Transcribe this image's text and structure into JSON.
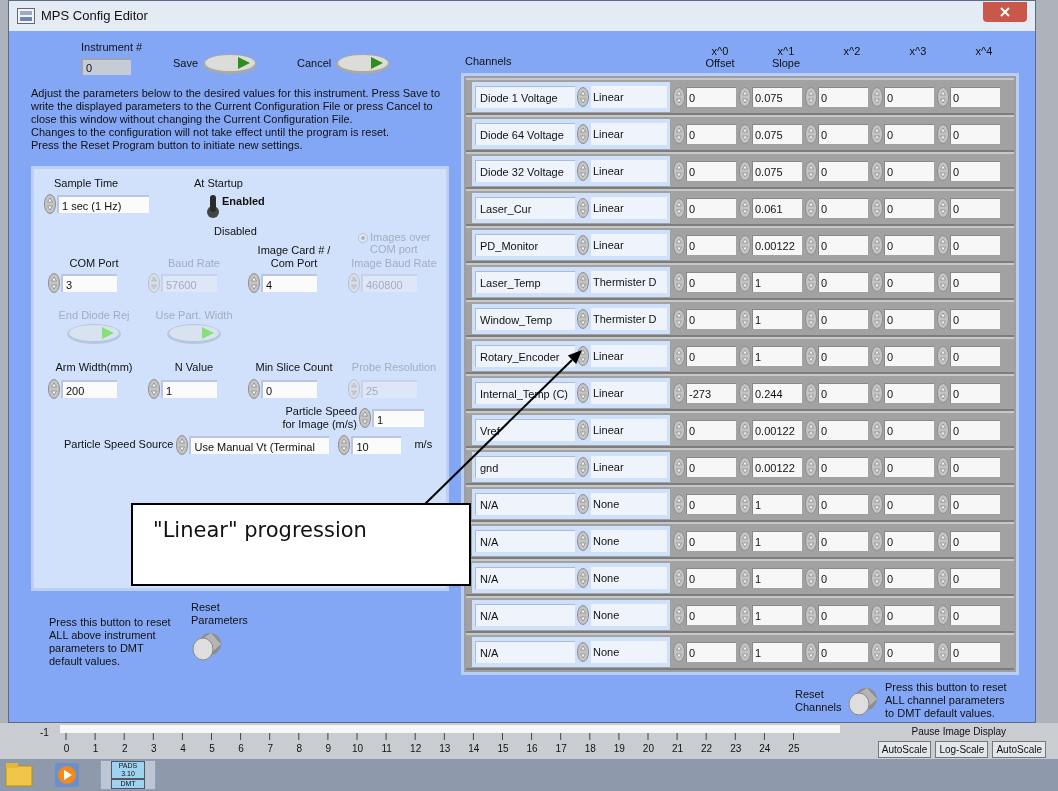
{
  "window": {
    "title": "MPS Config Editor"
  },
  "instrument": {
    "label": "Instrument #",
    "value": "0"
  },
  "actions": [
    {
      "label": "Save"
    },
    {
      "label": "Cancel"
    }
  ],
  "instructions": [
    "Adjust the parameters below to the desired values for this instrument.  Press Save to write the displayed parameters to the Current Configuration File or press Cancel to close this window without changing the Current Configuration File.",
    "Changes to the configuration will not take effect until the program is reset.",
    "Press the Reset Program button to initiate new settings."
  ],
  "sample_time": {
    "label": "Sample Time",
    "value": "1 sec (1 Hz)"
  },
  "at_startup": {
    "label": "At Startup",
    "on_label": "Enabled",
    "off_label": "Disabled",
    "enabled": true
  },
  "images_over_com": {
    "label": "Images over COM port",
    "checked": true,
    "disabled": true
  },
  "port_fields": [
    {
      "label": "COM Port",
      "value": "3",
      "disabled": false
    },
    {
      "label": "Baud Rate",
      "value": "57600",
      "disabled": true
    },
    {
      "label": "Image Card # / Com Port",
      "value": "4",
      "disabled": false
    },
    {
      "label": "Image Baud Rate",
      "value": "460800",
      "disabled": true
    }
  ],
  "switches": [
    {
      "label": "End Diode Rej",
      "disabled": true
    },
    {
      "label": "Use Part. Width",
      "disabled": true
    }
  ],
  "size_fields": [
    {
      "label": "Arm Width(mm)",
      "value": "200",
      "disabled": false
    },
    {
      "label": "N Value",
      "value": "1",
      "disabled": false
    },
    {
      "label": "Min Slice Count",
      "value": "0",
      "disabled": false
    },
    {
      "label": "Probe Resolution",
      "value": "25",
      "disabled": true
    }
  ],
  "particle_speed_image": {
    "label": "Particle Speed for Image (m/s)",
    "value": "1"
  },
  "particle_speed_source": {
    "label": "Particle Speed Source",
    "value": "Use Manual Vt (Terminal",
    "speed": "10",
    "unit": "m/s"
  },
  "reset_parameters": {
    "note": "Press this button to reset ALL above instrument parameters to DMT default values.",
    "label": "Reset Parameters"
  },
  "channels": {
    "title": "Channels",
    "columns": [
      {
        "power": "x^0",
        "name": "Offset"
      },
      {
        "power": "x^1",
        "name": "Slope"
      },
      {
        "power": "x^2"
      },
      {
        "power": "x^3"
      },
      {
        "power": "x^4"
      }
    ],
    "rows": [
      {
        "name": "Diode 1 Voltage",
        "type": "Linear",
        "coefficients": [
          "0",
          "0.075",
          "0",
          "0",
          "0"
        ]
      },
      {
        "name": "Diode 64 Voltage",
        "type": "Linear",
        "coefficients": [
          "0",
          "0.075",
          "0",
          "0",
          "0"
        ]
      },
      {
        "name": "Diode 32 Voltage",
        "type": "Linear",
        "coefficients": [
          "0",
          "0.075",
          "0",
          "0",
          "0"
        ]
      },
      {
        "name": "Laser_Cur",
        "type": "Linear",
        "coefficients": [
          "0",
          "0.061",
          "0",
          "0",
          "0"
        ]
      },
      {
        "name": "PD_Monitor",
        "type": "Linear",
        "coefficients": [
          "0",
          "0.00122",
          "0",
          "0",
          "0"
        ]
      },
      {
        "name": "Laser_Temp",
        "type": "Thermister D",
        "coefficients": [
          "0",
          "1",
          "0",
          "0",
          "0"
        ]
      },
      {
        "name": "Window_Temp",
        "type": "Thermister D",
        "coefficients": [
          "0",
          "1",
          "0",
          "0",
          "0"
        ]
      },
      {
        "name": "Rotary_Encoder",
        "type": "Linear",
        "coefficients": [
          "0",
          "1",
          "0",
          "0",
          "0"
        ]
      },
      {
        "name": "Internal_Temp (C)",
        "type": "Linear",
        "coefficients": [
          "-273",
          "0.244",
          "0",
          "0",
          "0"
        ]
      },
      {
        "name": "Vref",
        "type": "Linear",
        "coefficients": [
          "0",
          "0.00122",
          "0",
          "0",
          "0"
        ]
      },
      {
        "name": "gnd",
        "type": "Linear",
        "coefficients": [
          "0",
          "0.00122",
          "0",
          "0",
          "0"
        ]
      },
      {
        "name": "N/A",
        "type": "None",
        "coefficients": [
          "0",
          "1",
          "0",
          "0",
          "0"
        ]
      },
      {
        "name": "N/A",
        "type": "None",
        "coefficients": [
          "0",
          "1",
          "0",
          "0",
          "0"
        ]
      },
      {
        "name": "N/A",
        "type": "None",
        "coefficients": [
          "0",
          "1",
          "0",
          "0",
          "0"
        ]
      },
      {
        "name": "N/A",
        "type": "None",
        "coefficients": [
          "0",
          "1",
          "0",
          "0",
          "0"
        ]
      },
      {
        "name": "N/A",
        "type": "None",
        "coefficients": [
          "0",
          "1",
          "0",
          "0",
          "0"
        ]
      }
    ]
  },
  "reset_channels": {
    "label": "Reset Channels",
    "note": "Press this button to reset ALL channel parameters to DMT default values."
  },
  "annotation": {
    "text": "\"Linear\" progression"
  },
  "background": {
    "y_axis_label": "-1",
    "x_axis_labels": [
      "0",
      "1",
      "2",
      "3",
      "4",
      "5",
      "6",
      "7",
      "8",
      "9",
      "10",
      "11",
      "12",
      "13",
      "14",
      "15",
      "16",
      "17",
      "18",
      "19",
      "20",
      "21",
      "22",
      "23",
      "24",
      "25"
    ],
    "pause_label": "Pause Image Display",
    "scale_buttons": [
      "AutoScale",
      "Log-Scale",
      "AutoScale"
    ]
  },
  "taskbar": {
    "app_tile": "PADS 3.10",
    "app_tile_sub": "DMT"
  }
}
